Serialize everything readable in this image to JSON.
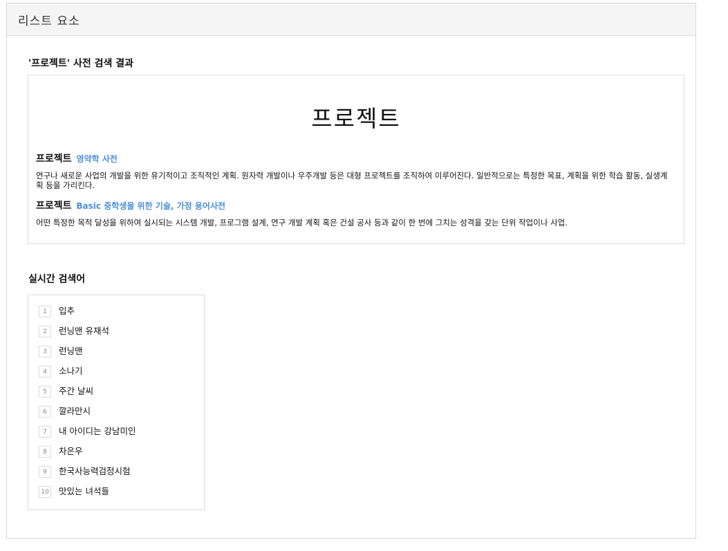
{
  "header": {
    "title": "리스트 요소"
  },
  "dictionary": {
    "section_title": "'프로젝트' 사전 검색 결과",
    "headword": "프로젝트",
    "entries": [
      {
        "word": "프로젝트",
        "source": "영약학 사전",
        "description": "연구나 새로운 사업의 개발을 위한 유기적이고 조직적인 계획. 원자력 개발이나 우주개발 등은 대형 프로젝트를 조직하여 이루어진다. 일반적으로는 특정한 목표, 계획을 위한 학습 활동, 실생계획 등을 가리킨다."
      },
      {
        "word": "프로젝트",
        "source": "Basic 중학생을 위한 기술, 가정 용어사전",
        "description": "어떤 특정한 목적 달성을 위하여 실시되는 시스템 개발, 프로그램 설계, 연구 개발 계획 혹은 건설 공사 등과 같이 한 번에 그치는 성격을 갖는 단위 작업이나 사업."
      }
    ]
  },
  "realtime": {
    "section_title": "실시간 검색어",
    "items": [
      {
        "rank": "1",
        "term": "입추"
      },
      {
        "rank": "2",
        "term": "런닝맨 유재석"
      },
      {
        "rank": "3",
        "term": "런닝맨"
      },
      {
        "rank": "4",
        "term": "소나기"
      },
      {
        "rank": "5",
        "term": "주간 날씨"
      },
      {
        "rank": "6",
        "term": "깔라만시"
      },
      {
        "rank": "7",
        "term": "내 아이디는 강남미인"
      },
      {
        "rank": "8",
        "term": "차은우"
      },
      {
        "rank": "9",
        "term": "한국사능력검정시험"
      },
      {
        "rank": "10",
        "term": "맛있는 녀석들"
      }
    ]
  }
}
